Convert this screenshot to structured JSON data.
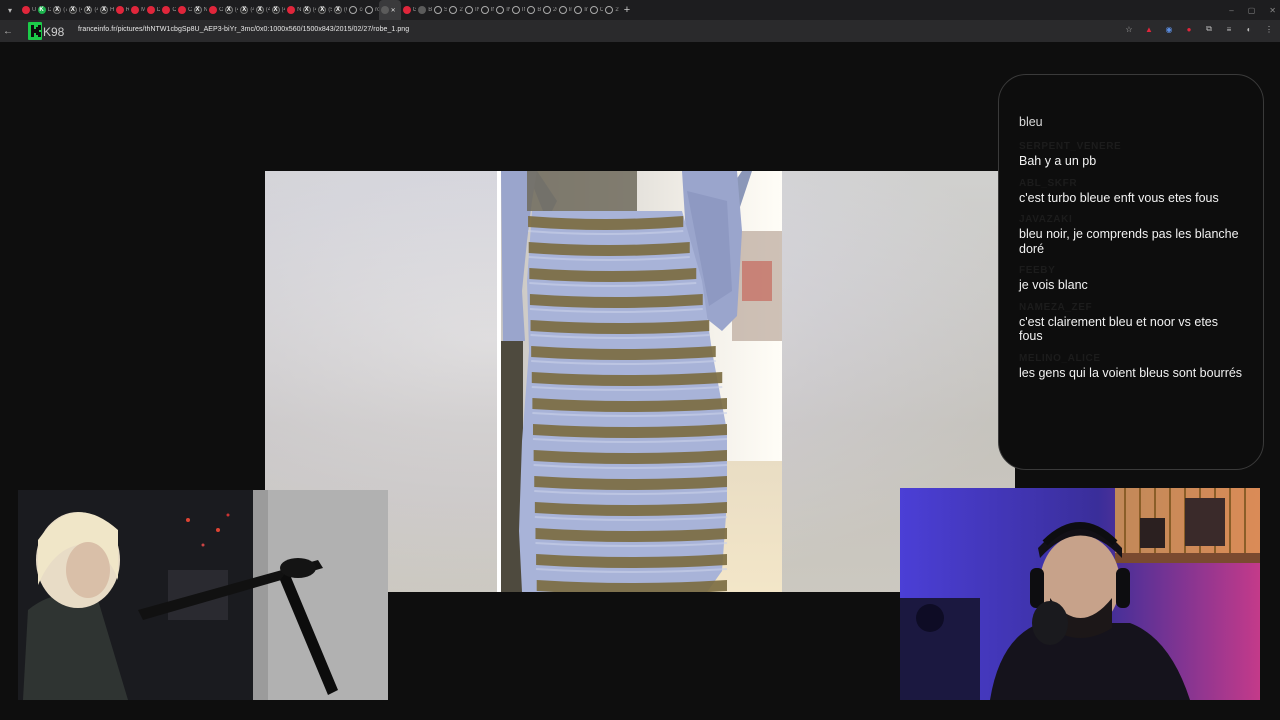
{
  "browser": {
    "tabs": [
      {
        "label": "Un",
        "favicon": "red"
      },
      {
        "label": "Dr",
        "favicon": "green-k"
      },
      {
        "label": "(7",
        "favicon": "x"
      },
      {
        "label": "(4",
        "favicon": "x"
      },
      {
        "label": "(4",
        "favicon": "x"
      },
      {
        "label": "Hi",
        "favicon": "x"
      },
      {
        "label": "Re",
        "favicon": "red"
      },
      {
        "label": "M",
        "favicon": "red"
      },
      {
        "label": "Dr",
        "favicon": "red"
      },
      {
        "label": "Cl",
        "favicon": "red"
      },
      {
        "label": "Co",
        "favicon": "red"
      },
      {
        "label": "Ni",
        "favicon": "x"
      },
      {
        "label": "Ol",
        "favicon": "red"
      },
      {
        "label": "(4",
        "favicon": "x"
      },
      {
        "label": "(4",
        "favicon": "x"
      },
      {
        "label": "(4",
        "favicon": "x"
      },
      {
        "label": "(4",
        "favicon": "x"
      },
      {
        "label": "Ni",
        "favicon": "red"
      },
      {
        "label": "(4",
        "favicon": "x"
      },
      {
        "label": "(5",
        "favicon": "x"
      },
      {
        "label": "(6",
        "favicon": "x"
      },
      {
        "label": "co",
        "favicon": "ring"
      },
      {
        "label": "ro",
        "favicon": "ring"
      },
      {
        "label": "",
        "favicon": "dots",
        "active": true
      },
      {
        "label": "Gl",
        "favicon": "red"
      },
      {
        "label": "Bo",
        "favicon": "dark"
      },
      {
        "label": "So",
        "favicon": "ring"
      },
      {
        "label": "20",
        "favicon": "ring"
      },
      {
        "label": "IN",
        "favicon": "ring"
      },
      {
        "label": "IN",
        "favicon": "ring"
      },
      {
        "label": "IN",
        "favicon": "ring"
      },
      {
        "label": "IN",
        "favicon": "ring"
      },
      {
        "label": "Bi",
        "favicon": "ring"
      },
      {
        "label": "20",
        "favicon": "ring"
      },
      {
        "label": "Im",
        "favicon": "ring"
      },
      {
        "label": "Im",
        "favicon": "ring"
      },
      {
        "label": "CC",
        "favicon": "ring"
      },
      {
        "label": "20",
        "favicon": "ring"
      }
    ],
    "url": "franceinfo.fr/pictures/thNTW1cbgSp8U_AEP3-biYr_3mc/0x0:1000x560/1500x843/2015/02/27/robe_1.png",
    "logo_text": "K98"
  },
  "chat": {
    "first_line": "bleu",
    "messages": [
      {
        "user": "SERPENT_VENERE",
        "text": "Bah y a un pb"
      },
      {
        "user": "ABL_SKFR",
        "text": "c'est turbo bleue enft vous etes fous"
      },
      {
        "user": "JAVAZAKI",
        "text": "bleu noir, je comprends pas les blanche doré"
      },
      {
        "user": "FEEBY",
        "text": "je vois blanc"
      },
      {
        "user": "NAMEZA_ZEF",
        "text": "c'est clairement bleu et noor vs etes fous"
      },
      {
        "user": "MELINO_ALICE",
        "text": "les gens qui la voient bleus sont bourrés"
      }
    ]
  },
  "colors": {
    "background": "#0e0e0e",
    "chat_border": "#3a3a3a",
    "tab_red": "#e0263b",
    "dress_blue": "#a8b3d8",
    "dress_gold": "#7a6a3f"
  }
}
